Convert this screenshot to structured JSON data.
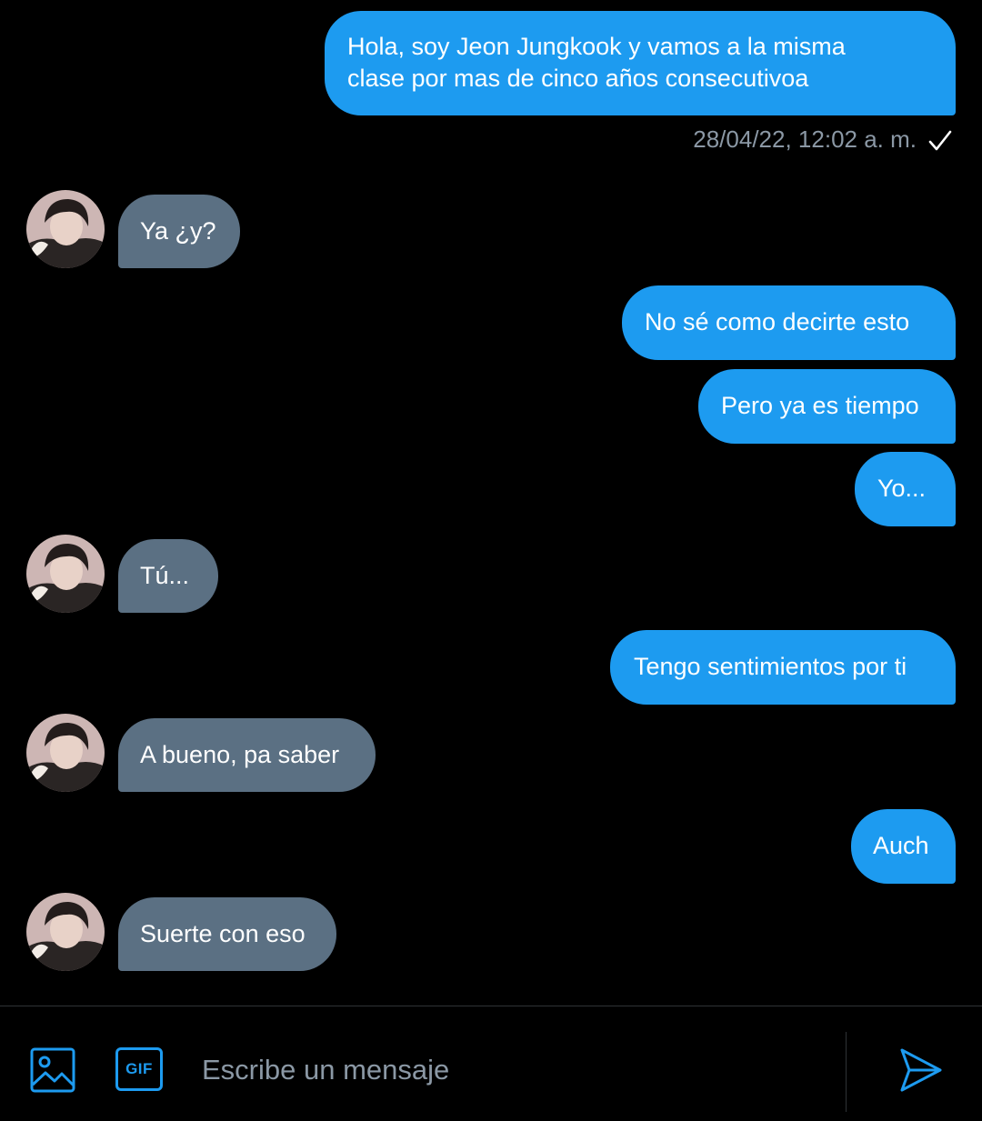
{
  "colors": {
    "sent_bubble": "#1d9bf0",
    "received_bubble": "#5b7083",
    "background": "#000000",
    "timestamp_text": "#8b98a5",
    "accent_icons": "#1d9bf0"
  },
  "messages": [
    {
      "direction": "sent",
      "lines": [
        "Hola, soy Jeon Jungkook y vamos a la misma",
        "clase por mas de cinco años consecutivoa"
      ]
    },
    {
      "direction": "received",
      "lines": [
        "Ya ¿y?"
      ]
    },
    {
      "direction": "sent",
      "lines": [
        "No sé como decirte esto"
      ]
    },
    {
      "direction": "sent",
      "lines": [
        "Pero ya es tiempo"
      ]
    },
    {
      "direction": "sent",
      "lines": [
        "Yo..."
      ]
    },
    {
      "direction": "received",
      "lines": [
        "Tú..."
      ]
    },
    {
      "direction": "sent",
      "lines": [
        "Tengo sentimientos por ti"
      ]
    },
    {
      "direction": "received",
      "lines": [
        "A bueno, pa saber"
      ]
    },
    {
      "direction": "sent",
      "lines": [
        "Auch"
      ]
    },
    {
      "direction": "received",
      "lines": [
        "Suerte con eso"
      ]
    }
  ],
  "first_message_meta": {
    "timestamp": "28/04/22, 12:02 a. m.",
    "status_icon": "check-icon"
  },
  "composer": {
    "placeholder": "Escribe un mensaje",
    "value": "",
    "image_icon": "image-icon",
    "gif_icon": "gif-icon",
    "gif_label": "GIF",
    "send_icon": "send-icon"
  }
}
